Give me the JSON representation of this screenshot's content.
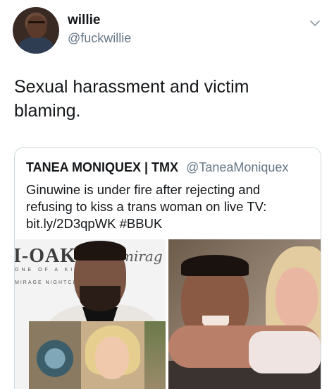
{
  "tweet": {
    "display_name": "willie",
    "handle": "@fuckwillie",
    "text_line1": "Sexual harassment and victim",
    "text_line2": "blaming."
  },
  "quote": {
    "display_name": "TANEA MONIQUEX | TMX",
    "handle": "@TaneaMoniquex",
    "text_line1": "Ginuwine is under fire after rejecting and",
    "text_line2": "refusing to kiss a trans woman on live TV:",
    "text_line3": "bit.ly/2D3qpWK #BBUK"
  },
  "media": {
    "left_brand": "I-OAK",
    "left_brand_sub": "ONE OF A KIND",
    "left_brand_sub2": "MIRAGE NIGHTCLUB",
    "left_script": "mirag"
  },
  "icons": {
    "caret": "chevron-down-icon"
  },
  "colors": {
    "secondary_text": "#657786",
    "border": "#cfd9de"
  }
}
